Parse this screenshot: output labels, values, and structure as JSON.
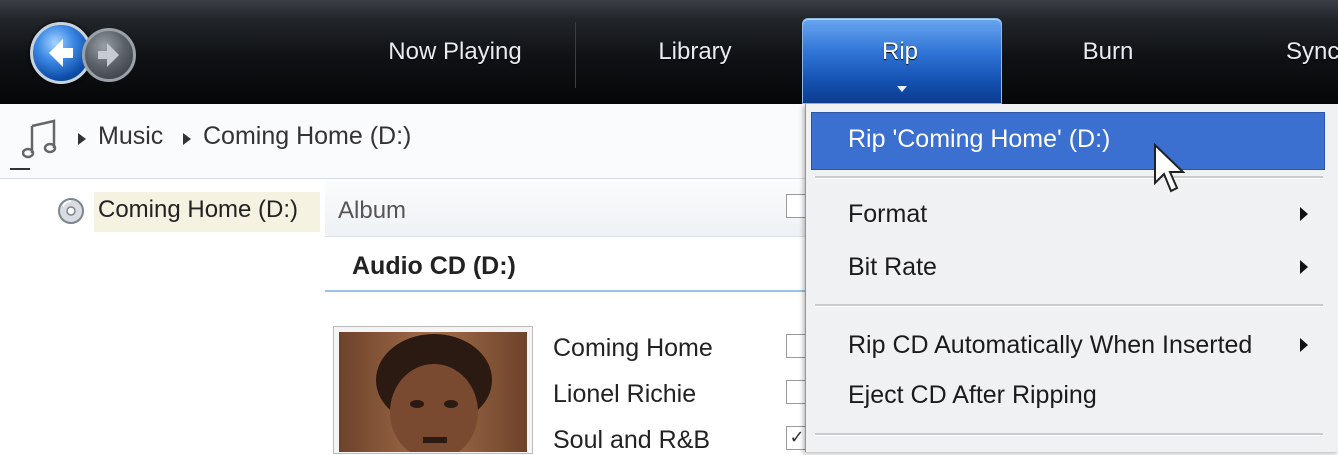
{
  "nav": {
    "tabs": [
      {
        "label": "Now Playing"
      },
      {
        "label": "Library"
      },
      {
        "label": "Rip"
      },
      {
        "label": "Burn"
      },
      {
        "label": "Sync"
      }
    ]
  },
  "breadcrumb": {
    "items": [
      "Music",
      "Coming Home (D:)"
    ]
  },
  "navpane": {
    "selected_item": "Coming Home (D:)"
  },
  "content": {
    "column_header": "Album",
    "group_title": "Audio CD (D:)",
    "album_info": [
      "Coming Home",
      "Lionel Richie",
      "Soul and R&B"
    ]
  },
  "rip_menu": {
    "items": [
      {
        "label": "Rip 'Coming Home' (D:)",
        "highlighted": true,
        "submenu": false
      },
      {
        "label": "Format",
        "submenu": true
      },
      {
        "label": "Bit Rate",
        "submenu": true
      },
      {
        "label": "Rip CD Automatically When Inserted",
        "submenu": true
      },
      {
        "label": "Eject CD After Ripping",
        "submenu": false
      }
    ]
  },
  "colors": {
    "highlight": "#3b6fd0",
    "active_tab": "#2f74d6",
    "topbar": "#0f1114"
  }
}
